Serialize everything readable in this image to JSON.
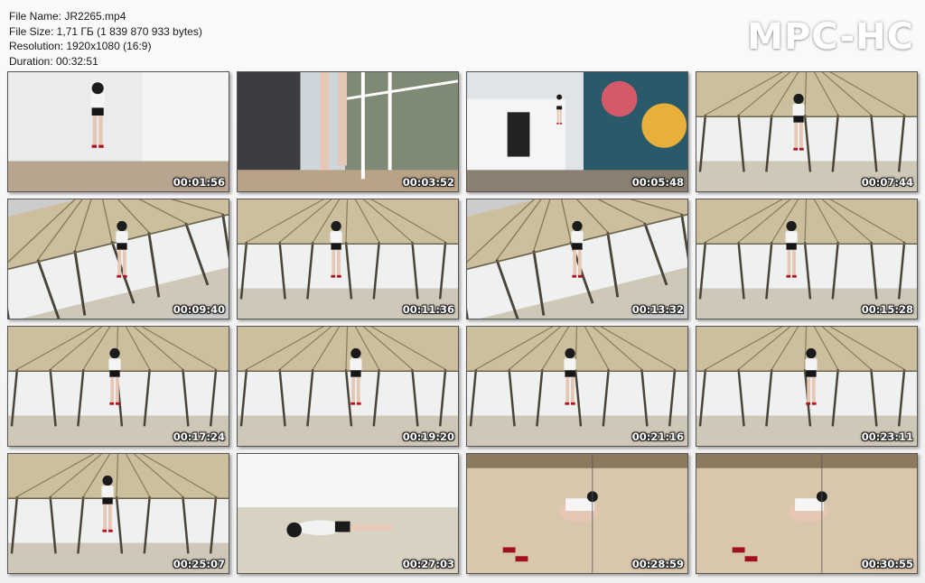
{
  "file_info": {
    "name": "File Name: JR2265.mp4",
    "size": "File Size: 1,71 ГБ (1 839 870 933 bytes)",
    "resolution": "Resolution: 1920x1080 (16:9)",
    "duration": "Duration: 00:32:51"
  },
  "brand": "MPC-HC",
  "thumbnails": [
    {
      "time": "00:01:56",
      "scene": "room"
    },
    {
      "time": "00:03:52",
      "scene": "balcony"
    },
    {
      "time": "00:05:48",
      "scene": "building"
    },
    {
      "time": "00:07:44",
      "scene": "tent"
    },
    {
      "time": "00:09:40",
      "scene": "tent-tilt"
    },
    {
      "time": "00:11:36",
      "scene": "tent"
    },
    {
      "time": "00:13:32",
      "scene": "tent-tilt"
    },
    {
      "time": "00:15:28",
      "scene": "tent"
    },
    {
      "time": "00:17:24",
      "scene": "tent"
    },
    {
      "time": "00:19:20",
      "scene": "tent"
    },
    {
      "time": "00:21:16",
      "scene": "tent"
    },
    {
      "time": "00:23:11",
      "scene": "tent"
    },
    {
      "time": "00:25:07",
      "scene": "tent"
    },
    {
      "time": "00:27:03",
      "scene": "floor"
    },
    {
      "time": "00:28:59",
      "scene": "rooftop"
    },
    {
      "time": "00:30:55",
      "scene": "rooftop"
    }
  ]
}
